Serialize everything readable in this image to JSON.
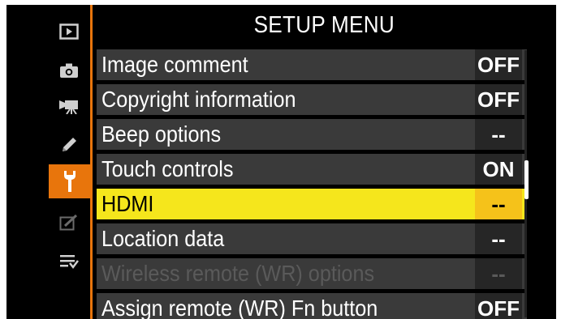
{
  "header": {
    "title": "SETUP MENU"
  },
  "sidebar": {
    "tabs": [
      {
        "icon": "playback-icon"
      },
      {
        "icon": "camera-icon"
      },
      {
        "icon": "movie-camera-icon"
      },
      {
        "icon": "pencil-icon"
      },
      {
        "icon": "wrench-icon",
        "active": true
      },
      {
        "icon": "retouch-icon"
      },
      {
        "icon": "my-menu-icon"
      }
    ]
  },
  "menu": {
    "items": [
      {
        "label": "Image comment",
        "value": "OFF"
      },
      {
        "label": "Copyright information",
        "value": "OFF"
      },
      {
        "label": "Beep options",
        "value": "--"
      },
      {
        "label": "Touch controls",
        "value": "ON"
      },
      {
        "label": "HDMI",
        "value": "--",
        "selected": true
      },
      {
        "label": "Location data",
        "value": "--"
      },
      {
        "label": "Wireless remote (WR) options",
        "value": "--",
        "disabled": true
      },
      {
        "label": "Assign remote (WR) Fn button",
        "value": "OFF"
      }
    ]
  },
  "colors": {
    "accent": "#e8750c",
    "highlight": "#f5e61c",
    "highlight_value": "#f5c21a"
  }
}
